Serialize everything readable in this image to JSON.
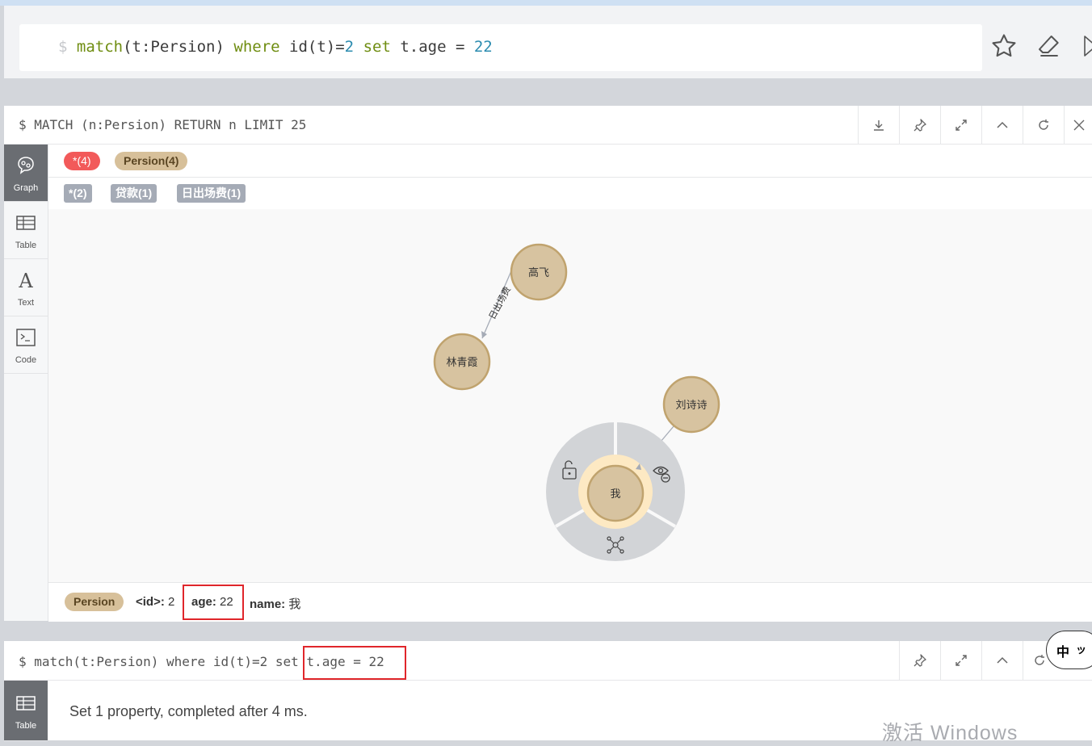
{
  "editor": {
    "prompt": "$",
    "kw_match": "match",
    "seg_paren_open": "(t:Persion) ",
    "kw_where": "where",
    "seg_id": " id(t)=",
    "num_id": "2",
    "kw_set": " set",
    "seg_prop": " t.age = ",
    "num_age": "22"
  },
  "frame1": {
    "title": "$ MATCH (n:Persion) RETURN n LIMIT 25",
    "tabs": [
      "Graph",
      "Table",
      "Text",
      "Code"
    ],
    "legend": {
      "node_all": "*(4)",
      "node_persion": "Persion(4)",
      "rel_all": "*(2)",
      "rel_loan": "贷款(1)",
      "rel_fee": "日出场费(1)"
    },
    "graph": {
      "nodes": [
        "高飞",
        "林青霞",
        "刘诗诗",
        "我"
      ],
      "edges": [
        "日出场费"
      ],
      "node_fill": "#d7c3a0",
      "node_stroke": "#c0a36e"
    },
    "info": {
      "label": "Persion",
      "id_key": "<id>:",
      "id_val": "2",
      "age_key": "age:",
      "age_val": "22",
      "name_key": "name:",
      "name_val": "我"
    }
  },
  "frame2": {
    "title_prefix": "$ match(t:Persion) where id(t)=2 set ",
    "title_highlight": "t.age = 22",
    "tab": "Table",
    "message": "Set 1 property, completed after 4 ms."
  },
  "watermark": "激活 Windows",
  "ime": {
    "char1": "中",
    "char2": "ッ"
  },
  "colors": {
    "accent_red": "#e0262b",
    "node_red": "#f25a5a",
    "persion_tan": "#d7c09a"
  }
}
